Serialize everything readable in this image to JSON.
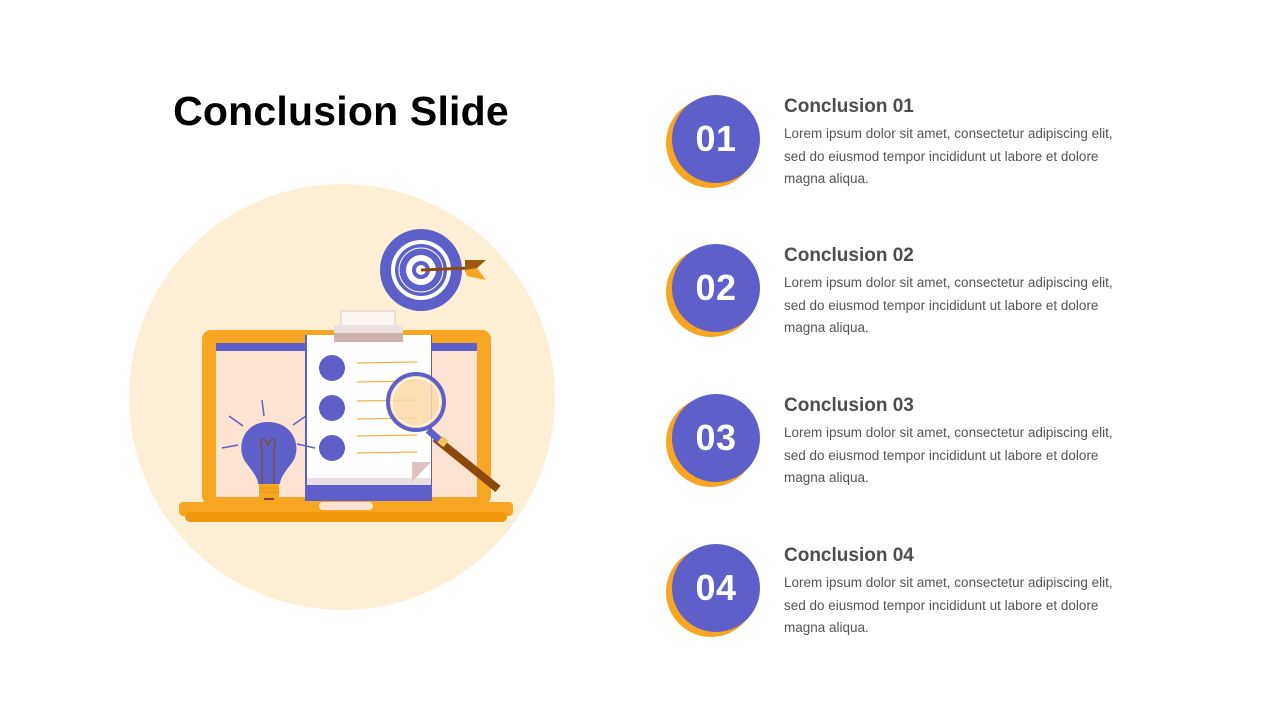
{
  "slide": {
    "title": "Conclusion Slide"
  },
  "colors": {
    "accent_purple": "#5F5FC9",
    "accent_orange": "#F6A623",
    "cream_circle": "#FDEFD5",
    "heading_text": "#4d4d4d",
    "body_text": "#555555"
  },
  "illustration": {
    "description": "laptop with clipboard checklist, light bulb, magnifying glass and dartboard target",
    "icons": [
      "laptop-icon",
      "clipboard-icon",
      "lightbulb-icon",
      "magnifying-glass-icon",
      "target-icon",
      "arrow-icon"
    ]
  },
  "items": [
    {
      "number": "01",
      "heading": "Conclusion 01",
      "lines": [
        "Lorem ipsum dolor sit amet, consectetur adipiscing elit,",
        "sed do eiusmod tempor incididunt ut labore et dolore",
        "magna aliqua."
      ]
    },
    {
      "number": "02",
      "heading": "Conclusion 02",
      "lines": [
        "Lorem ipsum dolor sit amet, consectetur adipiscing elit,",
        "sed do eiusmod tempor incididunt ut labore et dolore",
        "magna aliqua."
      ]
    },
    {
      "number": "03",
      "heading": "Conclusion 03",
      "lines": [
        "Lorem ipsum dolor sit amet, consectetur adipiscing elit,",
        "sed do eiusmod tempor incididunt ut labore et dolore",
        "magna aliqua."
      ]
    },
    {
      "number": "04",
      "heading": "Conclusion 04",
      "lines": [
        "Lorem ipsum dolor sit amet, consectetur adipiscing elit,",
        "sed do eiusmod tempor incididunt ut labore et dolore",
        "magna aliqua."
      ]
    }
  ]
}
